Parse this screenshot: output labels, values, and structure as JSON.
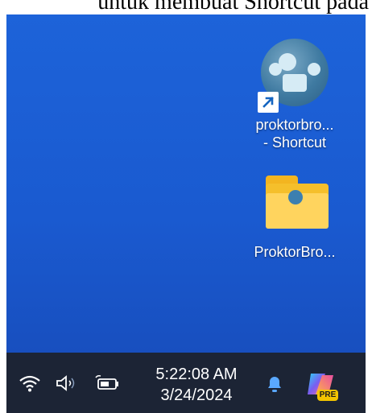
{
  "caption": "untuk membuat Shortcut pada",
  "desktop": {
    "icons": [
      {
        "label_line1": "proktorbro...",
        "label_line2": "- Shortcut",
        "icon": "proktor-app-icon",
        "badge": "shortcut-arrow-icon"
      },
      {
        "label_line1": "ProktorBro...",
        "icon": "folder-icon"
      }
    ]
  },
  "taskbar": {
    "time": "5:22:08 AM",
    "date": "3/24/2024",
    "tray_icons": [
      "wifi-icon",
      "volume-icon",
      "battery-icon",
      "notification-bell-icon",
      "copilot-icon"
    ],
    "copilot_badge": "PRE",
    "colors": {
      "bg": "#1c2435",
      "bell": "#5aa8ff"
    }
  },
  "colors": {
    "desktop": "#1d63d9"
  }
}
